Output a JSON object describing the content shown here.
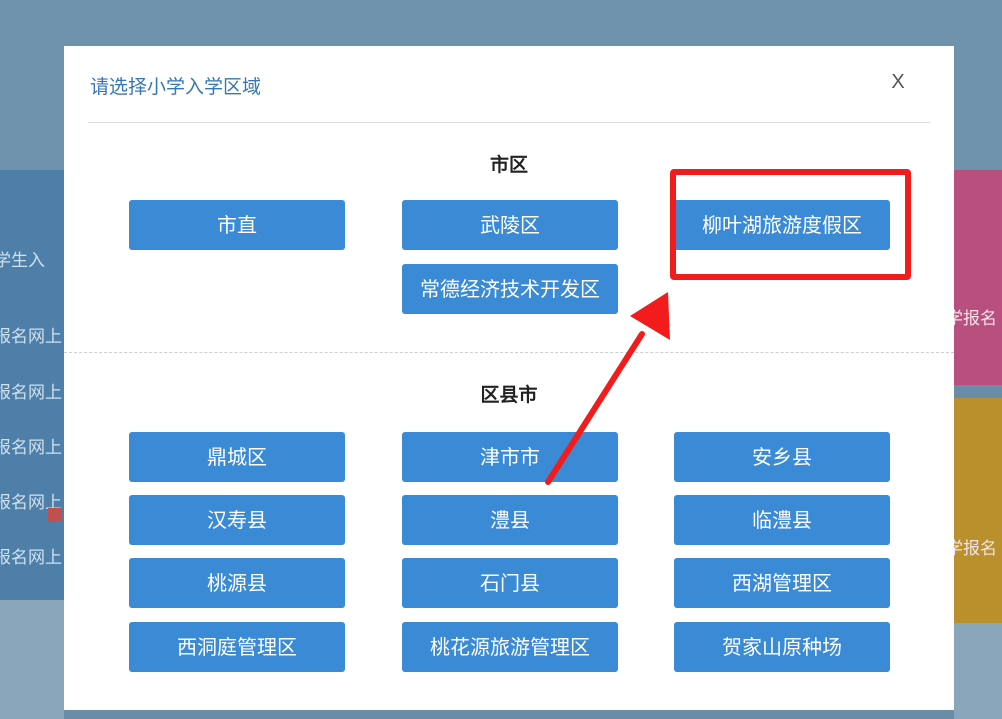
{
  "background": {
    "left_texts": [
      "学生入",
      "报名网上",
      "报名网上",
      "报名网上",
      "报名网上",
      "报名网上"
    ],
    "right_texts": [
      "学报名",
      "学报名"
    ]
  },
  "modal": {
    "title": "请选择小学入学区域",
    "close_label": "X",
    "sections": [
      {
        "title": "市区",
        "buttons": [
          "市直",
          "武陵区",
          "柳叶湖旅游度假区",
          "常德经济技术开发区"
        ]
      },
      {
        "title": "区县市",
        "buttons": [
          "鼎城区",
          "津市市",
          "安乡县",
          "汉寿县",
          "澧县",
          "临澧县",
          "桃源县",
          "石门县",
          "西湖管理区",
          "西洞庭管理区",
          "桃花源旅游管理区",
          "贺家山原种场"
        ]
      }
    ]
  },
  "annotation": {
    "highlight_color": "#f21c1c",
    "arrow_color": "#f21c1c"
  }
}
